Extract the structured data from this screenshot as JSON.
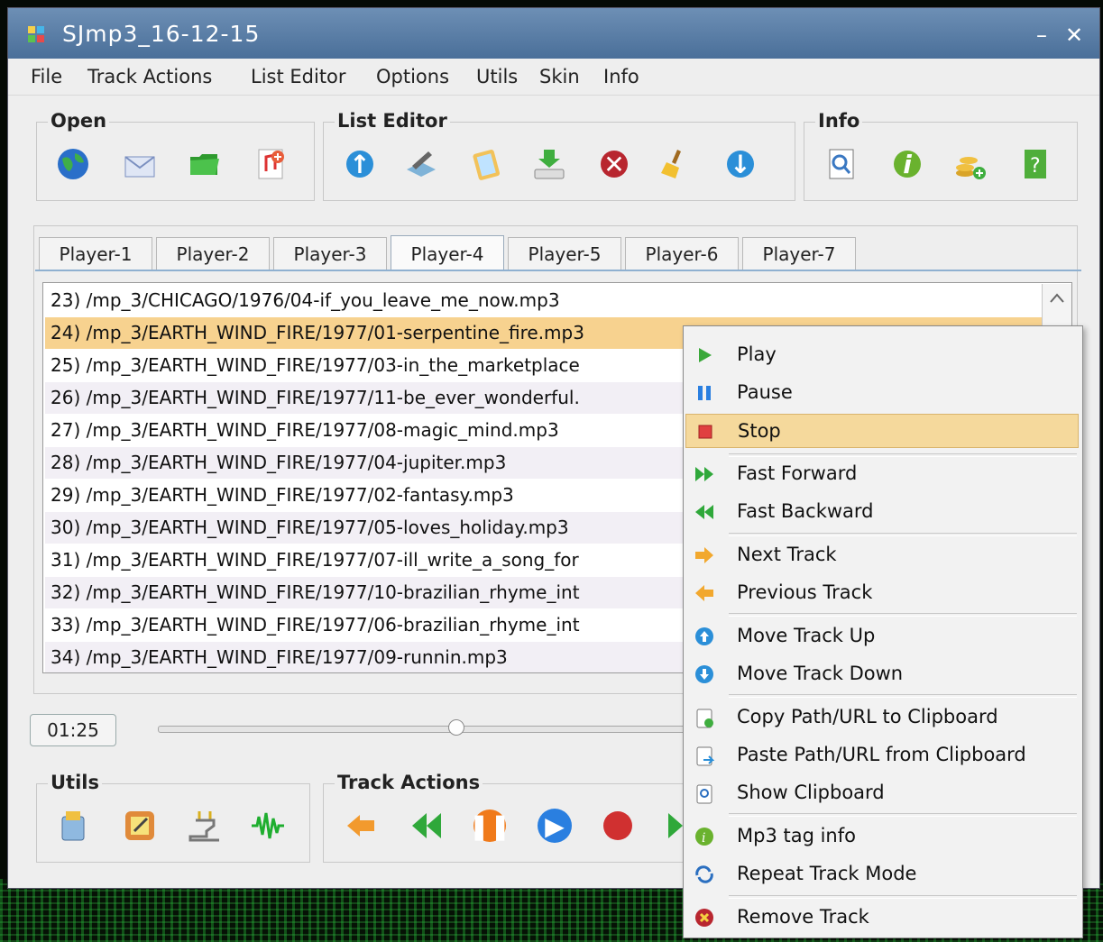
{
  "window": {
    "title": "SJmp3_16-12-15",
    "minimize": "–",
    "close": "✕"
  },
  "menubar": [
    "File",
    "Track Actions",
    "List Editor",
    "Options",
    "Utils",
    "Skin",
    "Info"
  ],
  "groups": {
    "open": "Open",
    "list_editor": "List Editor",
    "info": "Info",
    "utils": "Utils",
    "track_actions": "Track Actions"
  },
  "tabs": [
    "Player-1",
    "Player-2",
    "Player-3",
    "Player-4",
    "Player-5",
    "Player-6",
    "Player-7"
  ],
  "active_tab": "Player-4",
  "tracks": [
    "23) /mp_3/CHICAGO/1976/04-if_you_leave_me_now.mp3",
    "24) /mp_3/EARTH_WIND_FIRE/1977/01-serpentine_fire.mp3",
    "25) /mp_3/EARTH_WIND_FIRE/1977/03-in_the_marketplace",
    "26) /mp_3/EARTH_WIND_FIRE/1977/11-be_ever_wonderful.",
    "27) /mp_3/EARTH_WIND_FIRE/1977/08-magic_mind.mp3",
    "28) /mp_3/EARTH_WIND_FIRE/1977/04-jupiter.mp3",
    "29) /mp_3/EARTH_WIND_FIRE/1977/02-fantasy.mp3",
    "30) /mp_3/EARTH_WIND_FIRE/1977/05-loves_holiday.mp3",
    "31) /mp_3/EARTH_WIND_FIRE/1977/07-ill_write_a_song_for",
    "32) /mp_3/EARTH_WIND_FIRE/1977/10-brazilian_rhyme_int",
    "33) /mp_3/EARTH_WIND_FIRE/1977/06-brazilian_rhyme_int",
    "34) /mp_3/EARTH_WIND_FIRE/1977/09-runnin.mp3"
  ],
  "selected_track": "24) /mp_3/EARTH_WIND_FIRE/1977/01-serpentine_fire.mp3",
  "time": "01:25",
  "playback_position": 0.55,
  "context_menu": [
    {
      "label": "Play",
      "icon": "play-icon"
    },
    {
      "label": "Pause",
      "icon": "pause-icon"
    },
    {
      "label": "Stop",
      "icon": "stop-icon",
      "highlighted": true
    },
    {
      "label": "Fast Forward",
      "icon": "fast-forward-icon"
    },
    {
      "label": "Fast Backward",
      "icon": "fast-backward-icon"
    },
    {
      "label": "Next Track",
      "icon": "next-track-icon"
    },
    {
      "label": "Previous Track",
      "icon": "previous-track-icon"
    },
    {
      "label": "Move Track Up",
      "icon": "move-up-icon"
    },
    {
      "label": "Move Track Down",
      "icon": "move-down-icon"
    },
    {
      "label": "Copy Path/URL to Clipboard",
      "icon": "copy-clipboard-icon"
    },
    {
      "label": "Paste Path/URL from Clipboard",
      "icon": "paste-clipboard-icon"
    },
    {
      "label": "Show Clipboard",
      "icon": "show-clipboard-icon"
    },
    {
      "label": "Mp3 tag info",
      "icon": "info-icon"
    },
    {
      "label": "Repeat Track Mode",
      "icon": "repeat-icon"
    },
    {
      "label": "Remove Track",
      "icon": "remove-icon"
    }
  ],
  "colors": {
    "selection": "#f7d28f",
    "title_bar": "#4a6f99",
    "menu_hover": "#f5d99c"
  }
}
